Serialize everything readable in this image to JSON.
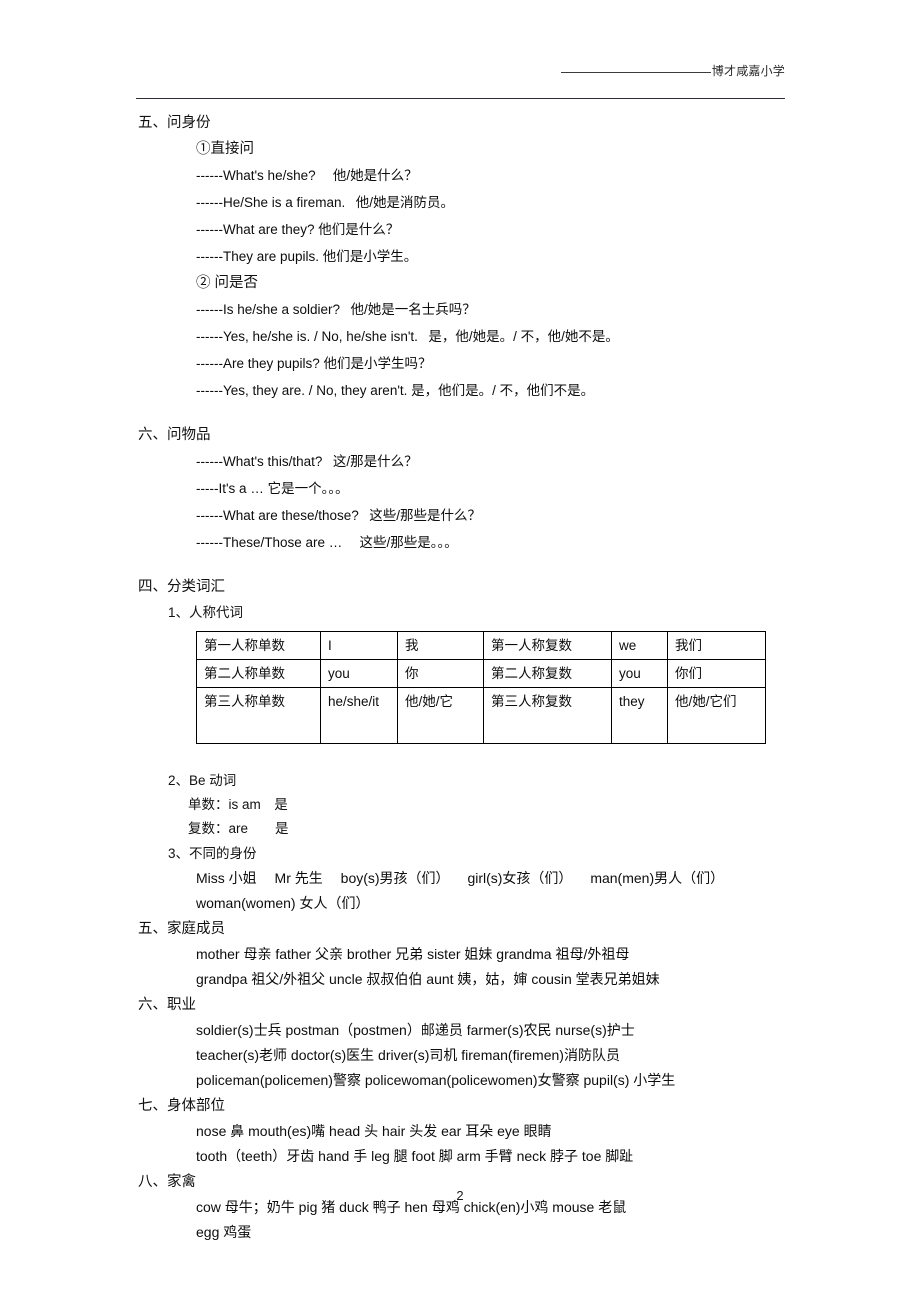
{
  "header": {
    "school": "博才咸嘉小学",
    "underline_prefix": ""
  },
  "footer": {
    "page_number": "2"
  },
  "sections": {
    "ask_identity": {
      "heading": "五、问身份",
      "sub1": "①直接问",
      "sub1_lines": [
        "------What's he/she?  他/她是什么？",
        "------He/She is a fireman.  他/她是消防员。",
        "------What are they?  他们是什么？",
        "------They are pupils.  他们是小学生。"
      ],
      "sub2": "②  问是否",
      "sub2_lines": [
        "------Is he/she a soldier?  他/她是一名士兵吗？",
        "------Yes, he/she is. / No, he/she isn't.  是，他/她是。/ 不，他/她不是。",
        "------Are they pupils?  他们是小学生吗？",
        "------Yes, they are. / No, they aren't.  是，他们是。/ 不，他们不是。"
      ]
    },
    "ask_objects": {
      "heading": "六、问物品",
      "lines": [
        "------What's this/that?  这/那是什么？",
        "-----It's a …  它是一个。。。",
        "------What are these/those?  这些/那些是什么？",
        "------These/Those are …  这些/那些是。。。"
      ]
    },
    "vocab_classified": {
      "heading": "四、分类词汇",
      "item1_label": "1、人称代词",
      "item2_label": "2、Be 动词",
      "be_singular": "单数：is am 是",
      "be_plural": "复数：are  是",
      "item3_label": "3、不同的身份",
      "identity_lines": [
        "Miss 小姐  Mr 先生  boy(s)男孩（们）  girl(s)女孩（们）  man(men)男人（们）",
        "woman(women)  女人（们）"
      ]
    },
    "family": {
      "heading": "五、家庭成员",
      "lines": [
        "mother 母亲  father 父亲  brother 兄弟  sister 姐妹  grandma 祖母/外祖母",
        "grandpa 祖父/外祖父  uncle 叔叔伯伯  aunt 姨，姑，婶  cousin 堂表兄弟姐妹"
      ]
    },
    "jobs": {
      "heading": "六、职业",
      "lines": [
        "soldier(s)士兵  postman（postmen）邮递员  farmer(s)农民  nurse(s)护士",
        "teacher(s)老师 doctor(s)医生  driver(s)司机  fireman(firemen)消防队员",
        "policeman(policemen)警察  policewoman(policewomen)女警察  pupil(s) 小学生"
      ]
    },
    "body_parts": {
      "heading": "七、身体部位",
      "lines": [
        "nose 鼻  mouth(es)嘴  head 头  hair 头发  ear 耳朵  eye 眼睛",
        "tooth（teeth）牙齿  hand 手  leg 腿  foot 脚  arm 手臂  neck 脖子  toe 脚趾"
      ]
    },
    "poultry": {
      "heading": "八、家禽",
      "lines": [
        "cow 母牛；奶牛  pig 猪  duck 鸭子  hen 母鸡  chick(en)小鸡  mouse 老鼠",
        "egg 鸡蛋"
      ]
    }
  },
  "pronoun_table": {
    "rows": [
      {
        "singular_label": "第一人称单数",
        "singular_en": "I",
        "singular_cn": "我",
        "plural_label": "第一人称复数",
        "plural_en": "we",
        "plural_cn": "我们"
      },
      {
        "singular_label": "第二人称单数",
        "singular_en": "you",
        "singular_cn": "你",
        "plural_label": "第二人称复数",
        "plural_en": "you",
        "plural_cn": "你们"
      },
      {
        "singular_label": "第三人称单数",
        "singular_en": "he/she/it",
        "singular_cn": "他/她/它",
        "plural_label": "第三人称复数",
        "plural_en": "they",
        "plural_cn": "他/她/它们"
      }
    ]
  }
}
